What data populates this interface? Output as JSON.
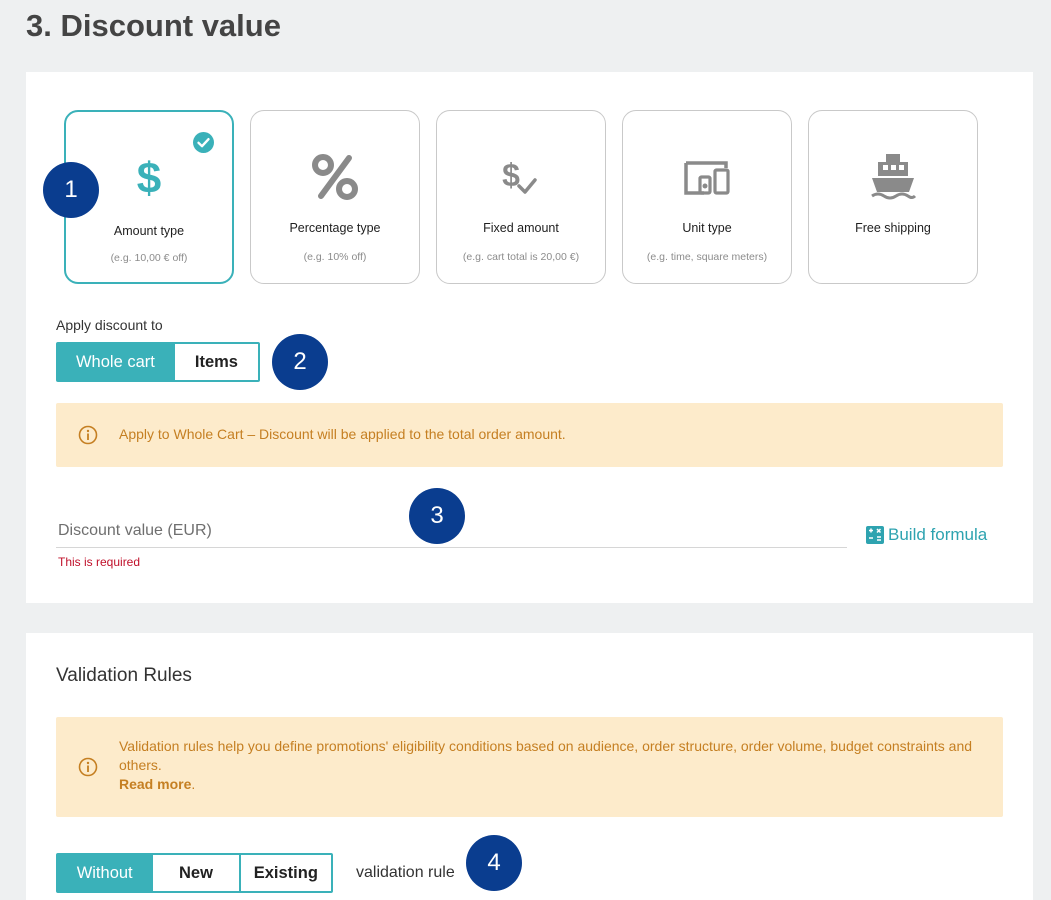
{
  "page_title": "3. Discount value",
  "discount_types": [
    {
      "label": "Amount type",
      "sub": "(e.g. 10,00 € off)",
      "icon": "dollar-icon",
      "selected": true
    },
    {
      "label": "Percentage type",
      "sub": "(e.g. 10% off)",
      "icon": "percent-icon",
      "selected": false
    },
    {
      "label": "Fixed amount",
      "sub": "(e.g. cart total is 20,00 €)",
      "icon": "dollar-check-icon",
      "selected": false
    },
    {
      "label": "Unit type",
      "sub": "(e.g. time, square meters)",
      "icon": "devices-icon",
      "selected": false
    },
    {
      "label": "Free shipping",
      "sub": "",
      "icon": "ship-icon",
      "selected": false
    }
  ],
  "steps": [
    "1",
    "2",
    "3",
    "4"
  ],
  "apply": {
    "label": "Apply discount to",
    "options": [
      "Whole cart",
      "Items"
    ],
    "selected": "Whole cart"
  },
  "apply_notice": "Apply to Whole Cart – Discount will be applied to the total order amount.",
  "discount_value": {
    "placeholder": "Discount value (EUR)",
    "value": "",
    "error": "This is required",
    "build_formula": "Build formula"
  },
  "validation": {
    "title": "Validation Rules",
    "notice": "Validation rules help you define promotions' eligibility conditions based on audience, order structure, order volume, budget constraints and others.",
    "read_more": "Read more",
    "read_more_suffix": ".",
    "options": [
      "Without",
      "New",
      "Existing"
    ],
    "selected": "Without",
    "suffix": "validation rule"
  },
  "colors": {
    "accent": "#3ab1b9",
    "step_badge": "#0a3d8f",
    "notice_bg": "#fdebcb",
    "notice_text": "#c57f22",
    "error": "#c0102a"
  }
}
